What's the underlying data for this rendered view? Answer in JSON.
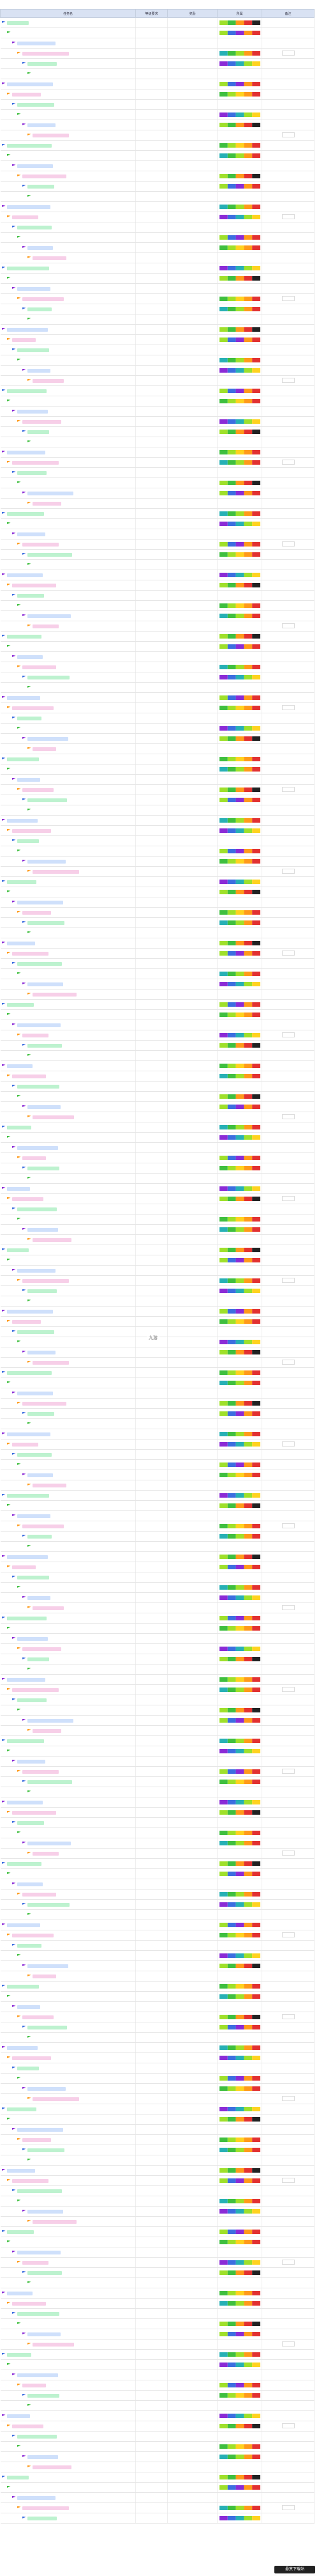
{
  "header": {
    "col_name": "任务名",
    "col_level": "等级要求",
    "col_reward": "奖励",
    "col_hub": "所属",
    "col_note": "备注"
  },
  "palette": {
    "lime": "#9fe02a",
    "green": "#3fbf3f",
    "orange": "#ff9a1a",
    "red": "#e23131",
    "blue": "#3c6ee0",
    "purple": "#8b2bd6",
    "teal": "#27b0b5",
    "dark": "#222222",
    "yellow": "#ffd21f"
  },
  "watermark": "九游",
  "logo": "悬赏下载站",
  "rows": []
}
